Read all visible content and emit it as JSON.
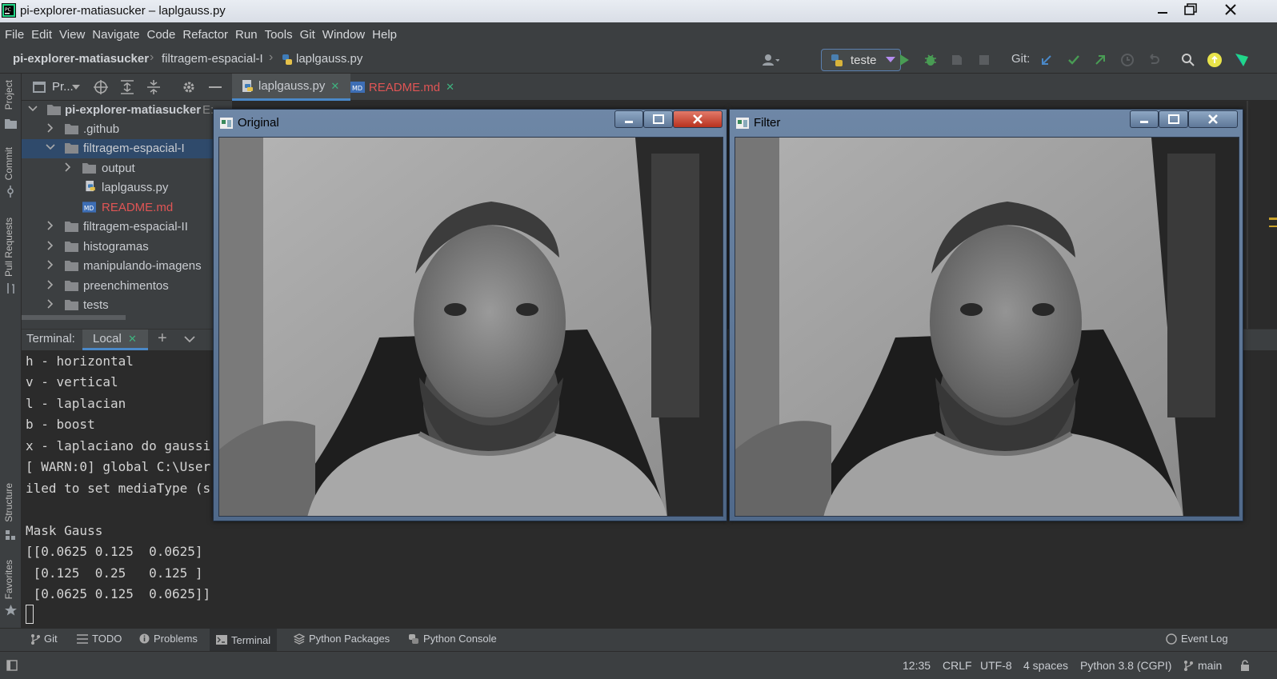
{
  "window": {
    "title": "pi-explorer-matiasucker – laplgauss.py"
  },
  "menu": [
    "File",
    "Edit",
    "View",
    "Navigate",
    "Code",
    "Refactor",
    "Run",
    "Tools",
    "Git",
    "Window",
    "Help"
  ],
  "breadcrumb": {
    "project": "pi-explorer-matiasucker",
    "folder": "filtragem-espacial-I",
    "file": "laplgauss.py"
  },
  "run_config": "teste",
  "git_label": "Git:",
  "project_panel": {
    "title": "Pr..."
  },
  "tree": [
    {
      "label": "pi-explorer-matiasucker",
      "suffix": "E:"
    },
    {
      "label": ".github"
    },
    {
      "label": "filtragem-espacial-I"
    },
    {
      "label": "output"
    },
    {
      "label": "laplgauss.py"
    },
    {
      "label": "README.md"
    },
    {
      "label": "filtragem-espacial-II"
    },
    {
      "label": "histogramas"
    },
    {
      "label": "manipulando-imagens"
    },
    {
      "label": "preenchimentos"
    },
    {
      "label": "tests"
    }
  ],
  "editor_tabs": [
    {
      "label": "laplgauss.py"
    },
    {
      "label": "README.md"
    }
  ],
  "terminal": {
    "label": "Terminal:",
    "tab": "Local",
    "lines": [
      "h - horizontal",
      "v - vertical",
      "l - laplacian",
      "b - boost",
      "x - laplaciano do gaussi",
      "[ WARN:0] global C:\\User",
      "iled to set mediaType (s",
      "",
      "Mask Gauss",
      "[[0.0625 0.125  0.0625]",
      " [0.125  0.25   0.125 ]",
      " [0.0625 0.125  0.0625]]"
    ]
  },
  "left_strip": [
    "Project",
    "Commit",
    "Pull Requests",
    "Structure",
    "Favorites"
  ],
  "bottom_tools": [
    "Git",
    "TODO",
    "Problems",
    "Terminal",
    "Python Packages",
    "Python Console",
    "Event Log"
  ],
  "status": {
    "position": "12:35",
    "line_sep": "CRLF",
    "encoding": "UTF-8",
    "indent": "4 spaces",
    "interpreter": "Python 3.8 (CGPI)",
    "branch": "main"
  },
  "cv_windows": [
    {
      "title": "Original"
    },
    {
      "title": "Filter"
    }
  ],
  "colors": {
    "accent": "#4a88c7",
    "run_green": "#499c54",
    "readme_red": "#e05555",
    "background": "#2b2b2b"
  }
}
